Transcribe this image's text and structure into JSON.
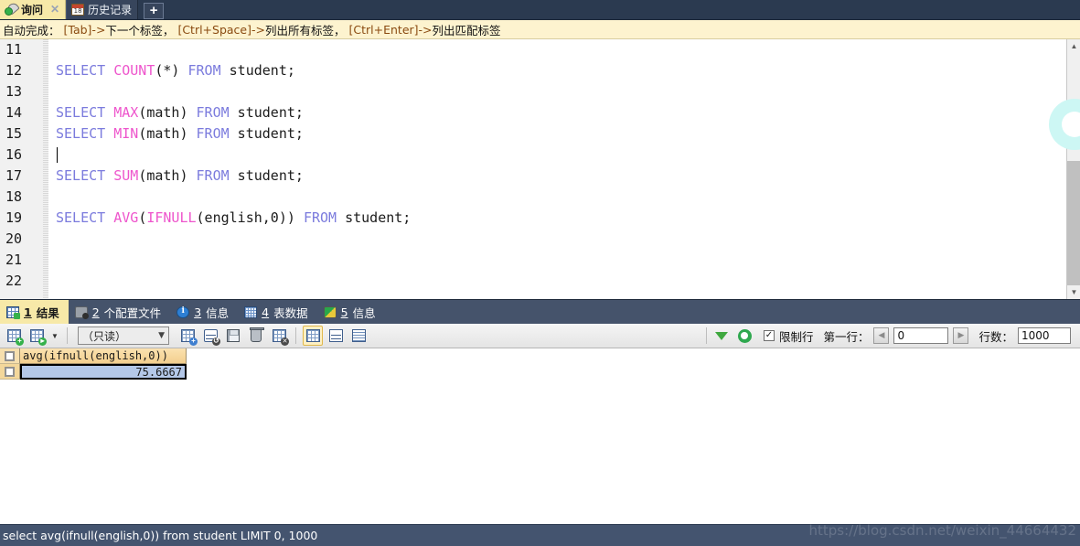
{
  "window": {
    "app": "Navicat SQL Editor"
  },
  "tabs": {
    "items": [
      {
        "label": "询问",
        "icon": "query-plug-icon",
        "active": true,
        "closable": true
      },
      {
        "label": "历史记录",
        "icon": "calendar-icon",
        "active": false,
        "closable": false
      }
    ],
    "add_label": "+"
  },
  "hint": {
    "prefix": "自动完成：",
    "segments": [
      {
        "key": "[Tab]->",
        "text": " 下一个标签，"
      },
      {
        "key": "[Ctrl+Space]->",
        "text": " 列出所有标签，"
      },
      {
        "key": "[Ctrl+Enter]->",
        "text": " 列出匹配标签"
      }
    ]
  },
  "editor": {
    "lines": [
      {
        "num": "11",
        "tokens": []
      },
      {
        "num": "12",
        "tokens": [
          {
            "t": "SELECT",
            "c": "kw"
          },
          {
            "t": " ",
            "c": "pn"
          },
          {
            "t": "COUNT",
            "c": "fn"
          },
          {
            "t": "(*) ",
            "c": "pn"
          },
          {
            "t": "FROM",
            "c": "kw"
          },
          {
            "t": " student;",
            "c": "pn"
          }
        ]
      },
      {
        "num": "13",
        "tokens": []
      },
      {
        "num": "14",
        "tokens": [
          {
            "t": "SELECT",
            "c": "kw"
          },
          {
            "t": " ",
            "c": "pn"
          },
          {
            "t": "MAX",
            "c": "fn"
          },
          {
            "t": "(math) ",
            "c": "pn"
          },
          {
            "t": "FROM",
            "c": "kw"
          },
          {
            "t": " student;",
            "c": "pn"
          }
        ]
      },
      {
        "num": "15",
        "tokens": [
          {
            "t": "SELECT",
            "c": "kw"
          },
          {
            "t": " ",
            "c": "pn"
          },
          {
            "t": "MIN",
            "c": "fn"
          },
          {
            "t": "(math) ",
            "c": "pn"
          },
          {
            "t": "FROM",
            "c": "kw"
          },
          {
            "t": " student;",
            "c": "pn"
          }
        ]
      },
      {
        "num": "16",
        "tokens": [],
        "caret": true
      },
      {
        "num": "17",
        "tokens": [
          {
            "t": "SELECT",
            "c": "kw"
          },
          {
            "t": " ",
            "c": "pn"
          },
          {
            "t": "SUM",
            "c": "fn"
          },
          {
            "t": "(math) ",
            "c": "pn"
          },
          {
            "t": "FROM",
            "c": "kw"
          },
          {
            "t": " student;",
            "c": "pn"
          }
        ]
      },
      {
        "num": "18",
        "tokens": []
      },
      {
        "num": "19",
        "tokens": [
          {
            "t": "SELECT",
            "c": "kw"
          },
          {
            "t": " ",
            "c": "pn"
          },
          {
            "t": "AVG",
            "c": "fn"
          },
          {
            "t": "(",
            "c": "pn"
          },
          {
            "t": "IFNULL",
            "c": "fn"
          },
          {
            "t": "(english,0)) ",
            "c": "pn"
          },
          {
            "t": "FROM",
            "c": "kw"
          },
          {
            "t": " student;",
            "c": "pn"
          }
        ]
      },
      {
        "num": "20",
        "tokens": []
      },
      {
        "num": "21",
        "tokens": []
      },
      {
        "num": "22",
        "tokens": []
      }
    ]
  },
  "result_tabs": {
    "items": [
      {
        "num": "1",
        "label": "结果",
        "icon": "result-grid-icon",
        "active": true
      },
      {
        "num": "2",
        "label": "个配置文件",
        "icon": "profile-icon",
        "active": false
      },
      {
        "num": "3",
        "label": "信息",
        "icon": "info-icon",
        "active": false
      },
      {
        "num": "4",
        "label": "表数据",
        "icon": "table-data-icon",
        "active": false
      },
      {
        "num": "5",
        "label": "信息",
        "icon": "message-icon",
        "active": false
      }
    ]
  },
  "grid_toolbar": {
    "mode_value": "（只读）",
    "buttons": [
      {
        "name": "apply-changes-icon",
        "label": ""
      },
      {
        "name": "stop-changes-icon",
        "label": ""
      },
      {
        "name": "add-record-icon",
        "label": ""
      },
      {
        "name": "refresh-record-icon",
        "label": ""
      },
      {
        "name": "save-record-icon",
        "label": ""
      },
      {
        "name": "delete-record-icon",
        "label": ""
      },
      {
        "name": "discard-changes-icon",
        "label": ""
      }
    ],
    "views": [
      {
        "name": "grid-view-icon",
        "active": true
      },
      {
        "name": "form-view-icon",
        "active": false
      },
      {
        "name": "text-view-icon",
        "active": false
      }
    ],
    "filter_icon": "filter-funnel-icon",
    "refresh_icon": "refresh-icon",
    "limit_label": "限制行",
    "limit_checked": true,
    "first_row_label": "第一行：",
    "first_row_value": "0",
    "row_count_label": "行数：",
    "row_count_value": "1000"
  },
  "result_grid": {
    "columns": [
      "avg(ifnull(english,0))"
    ],
    "rows": [
      [
        "75.6667"
      ]
    ]
  },
  "status": {
    "text": "select avg(ifnull(english,0)) from student LIMIT 0, 1000",
    "watermark": "https://blog.csdn.net/weixin_44664432"
  },
  "colors": {
    "tab_active_bg": "#f7e9a8",
    "chrome_bg": "#2b3a50",
    "hint_bg": "#fdf3cf",
    "keyword": "#7b7bdd",
    "function": "#ee55cc",
    "grid_header": "#f3cf8e",
    "cell_selected": "#b4c8e8",
    "statusbar_bg": "#44546f"
  }
}
